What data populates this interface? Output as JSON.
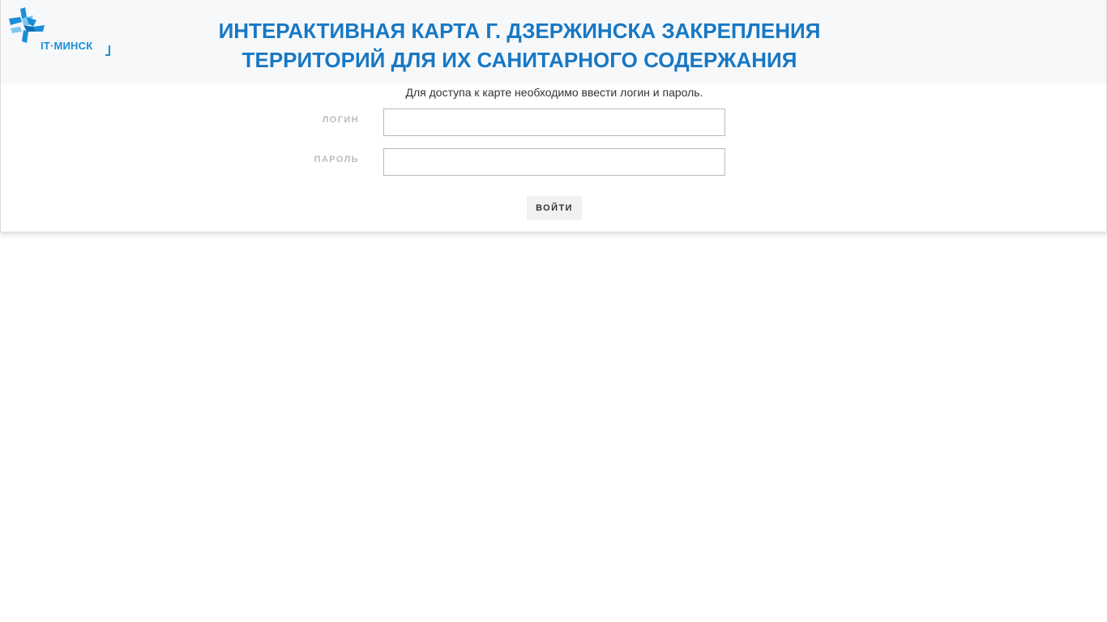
{
  "header": {
    "logo_text": "IT·МИНСК",
    "title_line1": "ИНТЕРАКТИВНАЯ КАРТА Г. ДЗЕРЖИНСКА ЗАКРЕПЛЕНИЯ",
    "title_line2": "ТЕРРИТОРИЙ ДЛЯ ИХ САНИТАРНОГО СОДЕРЖАНИЯ"
  },
  "form": {
    "notice": "Для доступа к карте необходимо ввести логин и пароль.",
    "login_label": "ЛОГИН",
    "login_value": "",
    "password_label": "ПАРОЛЬ",
    "password_value": "",
    "submit_label": "ВОЙТИ"
  },
  "colors": {
    "title": "#1778c4",
    "logo": "#1a8fd8",
    "header_bg": "#f7f8fa"
  },
  "icons": {
    "logo": "it-minsk-logo-icon"
  }
}
